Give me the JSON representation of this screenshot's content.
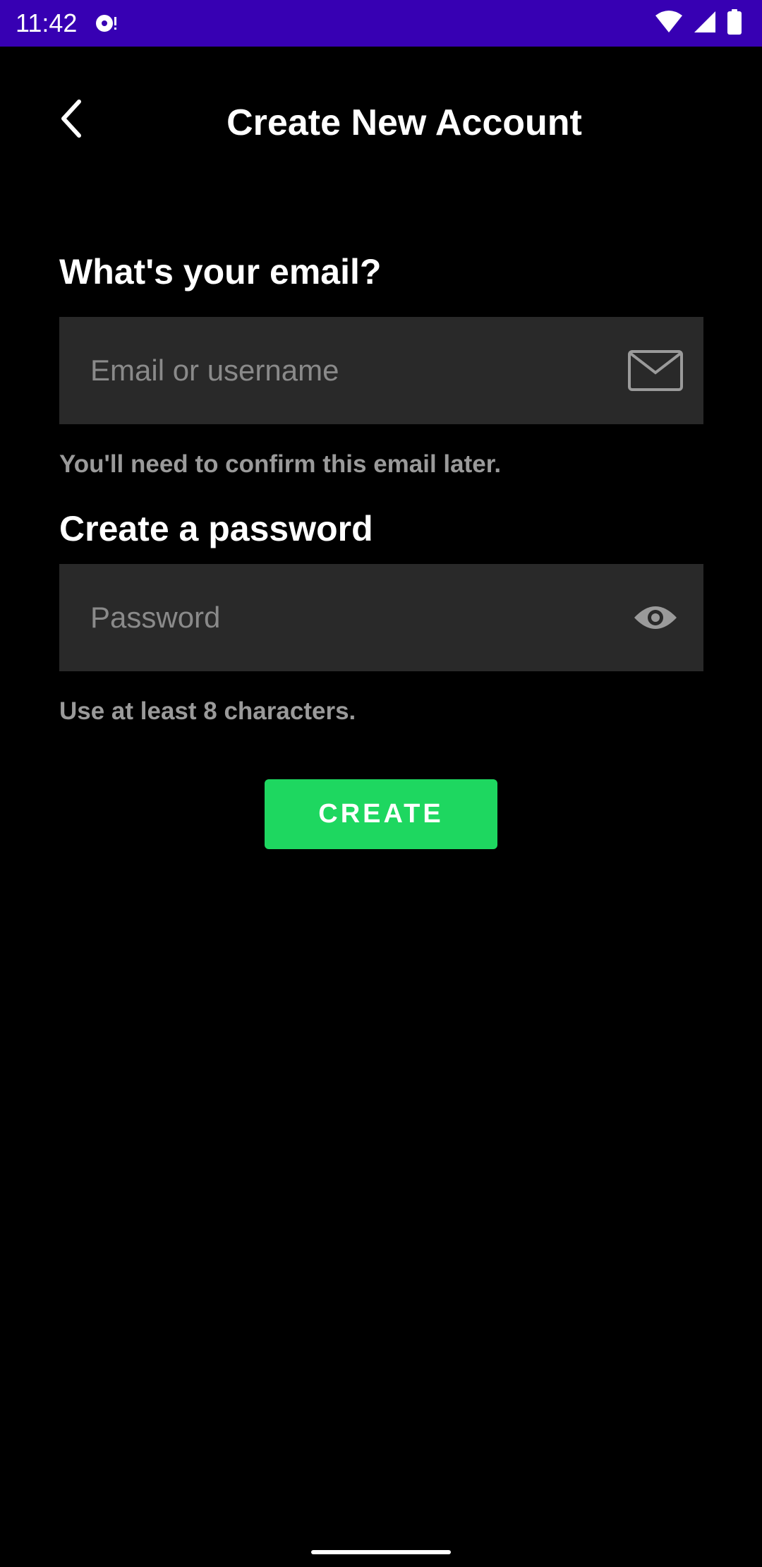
{
  "status_bar": {
    "time": "11:42",
    "background": "#3700b3",
    "icons": [
      "media-notification-icon",
      "wifi-icon",
      "cell-signal-icon",
      "battery-icon"
    ]
  },
  "header": {
    "back_icon": "chevron-left-icon",
    "title": "Create New Account"
  },
  "form": {
    "email": {
      "label": "What's your email?",
      "placeholder": "Email or username",
      "value": "",
      "icon": "mail-icon",
      "hint": "You'll need to confirm this email later."
    },
    "password": {
      "label": "Create a password",
      "placeholder": "Password",
      "value": "",
      "icon": "eye-icon",
      "hint": "Use at least 8 characters."
    },
    "submit_label": "CREATE"
  },
  "colors": {
    "background": "#000000",
    "field_background": "#292929",
    "accent": "#1ed760",
    "hint_text": "#9a9a9a"
  }
}
